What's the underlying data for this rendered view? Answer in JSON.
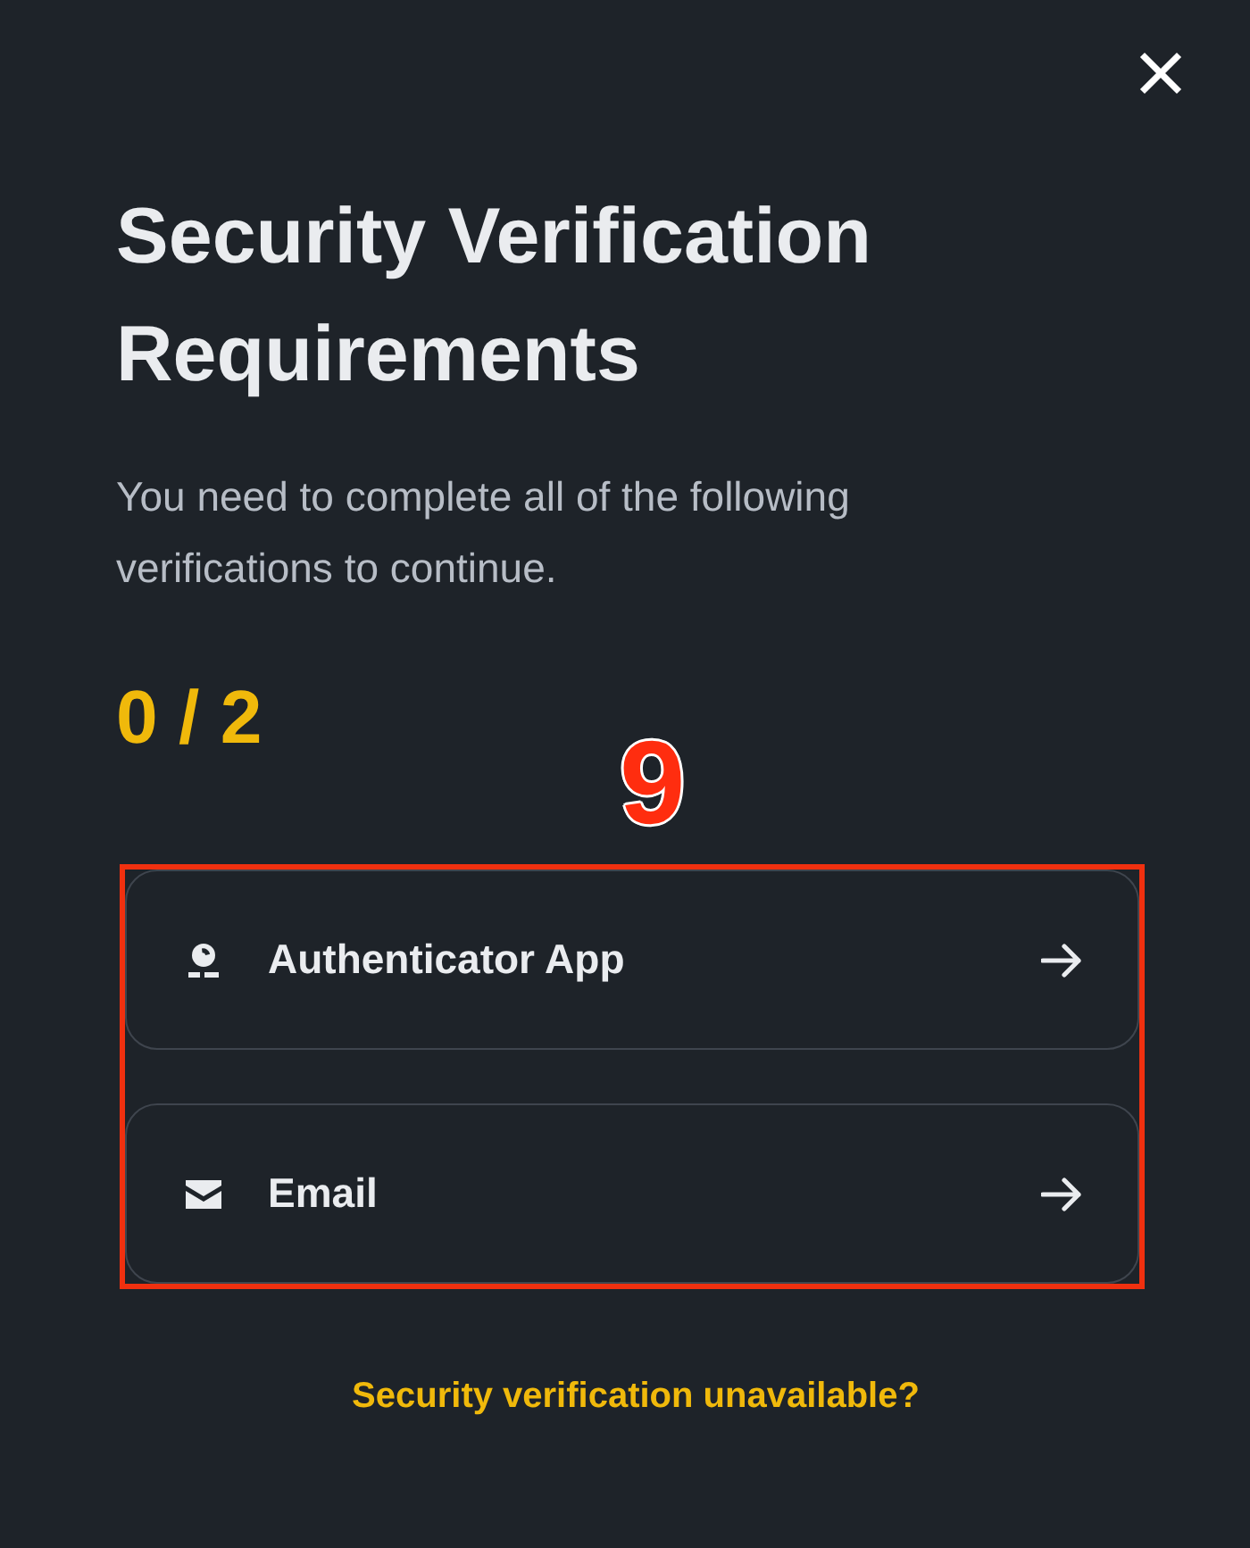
{
  "dialog": {
    "title": "Security Verification Requirements",
    "description": "You need to complete all of the following verifications to continue.",
    "progress": "0 / 2",
    "methods": [
      {
        "kind": "authenticator",
        "label": "Authenticator App"
      },
      {
        "kind": "email",
        "label": "Email"
      }
    ],
    "help_link": "Security verification unavailable?"
  },
  "annotation": {
    "step": "9",
    "highlight": true
  }
}
